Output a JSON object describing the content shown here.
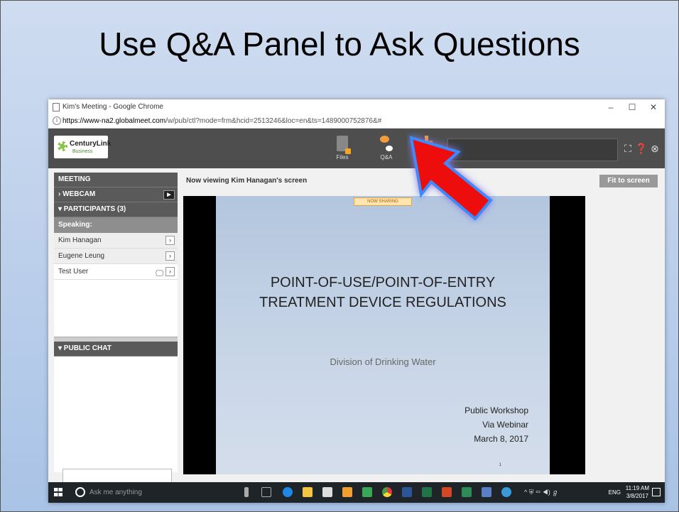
{
  "slide": {
    "title": "Use Q&A Panel to Ask Questions"
  },
  "browser": {
    "window_title": "Kim's Meeting - Google Chrome",
    "url_host": "https://www-na2.globalmeet.com",
    "url_path": "/w/pub/ctl?mode=frm&hcid=2513246&loc=en&ts=1489000752876&#",
    "controls": {
      "minimize": "–",
      "maximize": "☐",
      "close": "✕"
    }
  },
  "app": {
    "logo_name": "CenturyLink",
    "logo_sub": "Business",
    "toolbar": {
      "files_label": "Files",
      "qa_label": "Q&A"
    },
    "header_icons": [
      "fullscreen-icon",
      "help-icon",
      "close-icon"
    ]
  },
  "left_panel": {
    "meeting_header": "MEETING",
    "webcam_header": "› WEBCAM",
    "participants_header": "▾ PARTICIPANTS (3)",
    "speaking_label": "Speaking:",
    "participants": [
      "Kim Hanagan",
      "Eugene Leung",
      "Test User"
    ],
    "public_chat_header": "▾ PUBLIC CHAT"
  },
  "main": {
    "viewing_text": "Now viewing Kim Hanagan's screen",
    "fit_button": "Fit to screen",
    "sharing_badge": "NOW SHARING"
  },
  "shared_slide": {
    "title_line1": "POINT-OF-USE/POINT-OF-ENTRY",
    "title_line2": "TREATMENT DEVICE REGULATIONS",
    "division": "Division of Drinking Water",
    "line1": "Public Workshop",
    "line2": "Via Webinar",
    "line3": "March 8, 2017",
    "page_number": "1"
  },
  "taskbar": {
    "search_placeholder": "Ask me anything",
    "language": "ENG",
    "time": "11:19 AM",
    "date": "3/8/2017"
  },
  "colors": {
    "accent_orange": "#f39c3c",
    "arrow_red": "#ee1111",
    "arrow_glow": "#3a8bff"
  }
}
